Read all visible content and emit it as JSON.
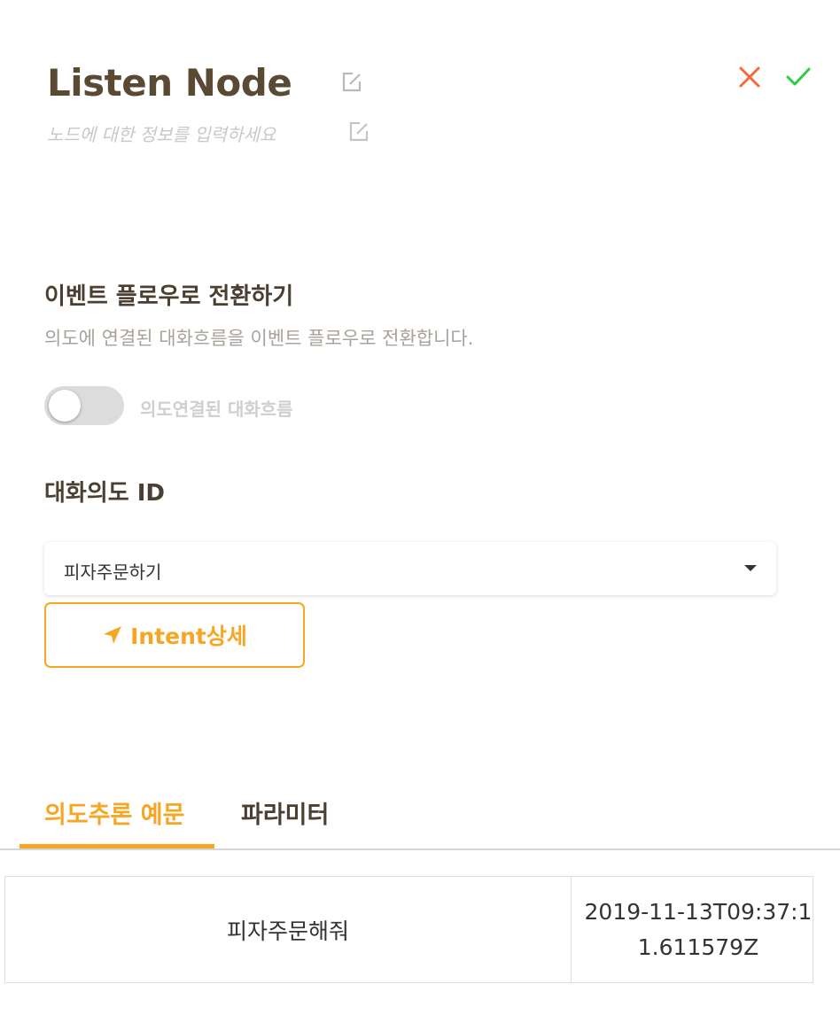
{
  "header": {
    "title": "Listen Node",
    "description_placeholder": "노드에 대한 정보를 입력하세요"
  },
  "actions": {
    "close_icon": "x-icon",
    "confirm_icon": "check-icon"
  },
  "event_flow": {
    "title": "이벤트 플로우로 전환하기",
    "description": "의도에 연결된 대화흐름을 이벤트 플로우로 전환합니다.",
    "toggle_label": "의도연결된 대화흐름",
    "toggle_on": false
  },
  "intent": {
    "field_title": "대화의도 ID",
    "selected": "피자주문하기",
    "detail_button_label": "Intent상세"
  },
  "tabs": [
    {
      "label": "의도추론 예문",
      "active": true
    },
    {
      "label": "파라미터",
      "active": false
    }
  ],
  "examples_table": {
    "rows": [
      {
        "text": "피자주문해줘",
        "created": "2019-11-13T09:37:11.611579Z"
      }
    ]
  },
  "colors": {
    "accent": "#f5a623",
    "title": "#5a4a34",
    "close": "#f26a3c",
    "confirm": "#2ecc40"
  }
}
